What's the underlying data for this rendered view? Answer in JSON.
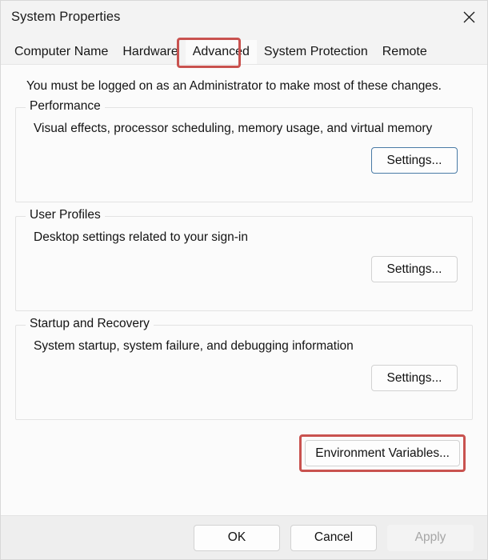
{
  "window": {
    "title": "System Properties",
    "close_icon": "close-icon"
  },
  "tabs": [
    {
      "label": "Computer Name",
      "selected": false
    },
    {
      "label": "Hardware",
      "selected": false
    },
    {
      "label": "Advanced",
      "selected": true
    },
    {
      "label": "System Protection",
      "selected": false
    },
    {
      "label": "Remote",
      "selected": false
    }
  ],
  "content": {
    "notice": "You must be logged on as an Administrator to make most of these changes.",
    "groups": [
      {
        "legend": "Performance",
        "description": "Visual effects, processor scheduling, memory usage, and virtual memory",
        "button_label": "Settings..."
      },
      {
        "legend": "User Profiles",
        "description": "Desktop settings related to your sign-in",
        "button_label": "Settings..."
      },
      {
        "legend": "Startup and Recovery",
        "description": "System startup, system failure, and debugging information",
        "button_label": "Settings..."
      }
    ],
    "environment_variables_label": "Environment Variables..."
  },
  "footer": {
    "ok_label": "OK",
    "cancel_label": "Cancel",
    "apply_label": "Apply"
  },
  "colors": {
    "annotation_red": "#c9524f",
    "focus_blue": "#4a7ba6",
    "dialog_background": "#f3f3f3",
    "content_background": "#fbfbfb",
    "footer_background": "#eeeeee",
    "text": "#141414",
    "disabled_text": "#a6a6a6"
  }
}
